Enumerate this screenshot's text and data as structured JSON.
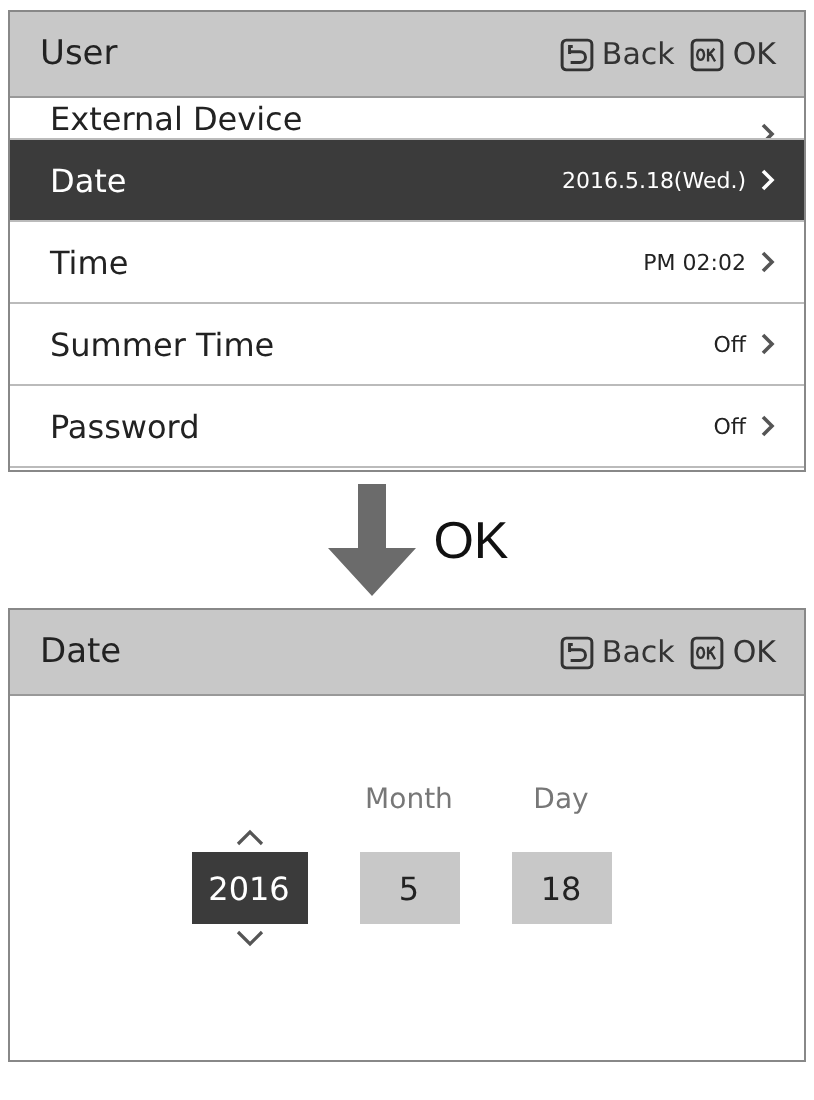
{
  "menu_screen": {
    "title": "User",
    "header_buttons": [
      {
        "kind": "back",
        "label": "Back"
      },
      {
        "kind": "ok",
        "label": "OK"
      }
    ],
    "rows": [
      {
        "label": "External Device",
        "partial": true,
        "selected": false
      },
      {
        "label": "Date",
        "value": "2016.5.18(Wed.)",
        "selected": true
      },
      {
        "label": "Time",
        "value": "PM 02:02",
        "selected": false
      },
      {
        "label": "Summer Time",
        "value": "Off",
        "selected": false
      },
      {
        "label": "Password",
        "value": "Off",
        "selected": false
      }
    ]
  },
  "step": {
    "label": "OK"
  },
  "date_screen": {
    "title": "Date",
    "header_buttons": [
      {
        "kind": "back",
        "label": "Back"
      },
      {
        "kind": "ok",
        "label": "OK"
      }
    ],
    "fields": [
      {
        "value": "2016",
        "selected": true
      },
      {
        "label": "Month",
        "value": "5",
        "selected": false
      },
      {
        "label": "Day",
        "value": "18",
        "selected": false
      }
    ]
  }
}
